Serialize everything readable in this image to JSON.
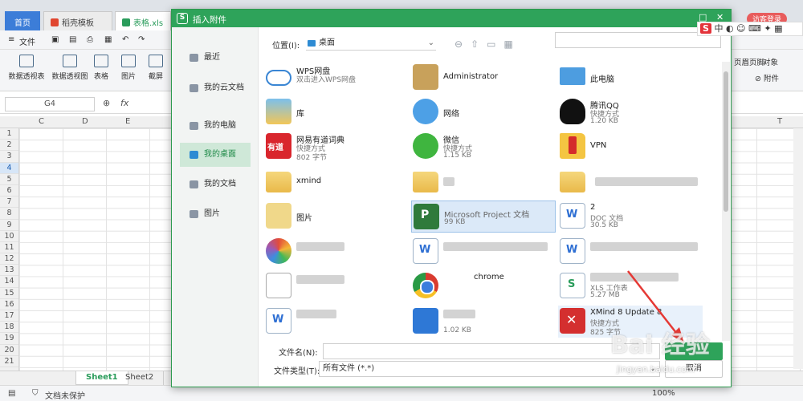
{
  "app": {
    "tabs": {
      "home": "首页",
      "templates": "稻壳模板",
      "file": "表格.xls"
    },
    "visitor": "访客登录",
    "menu": {
      "file": "文件"
    },
    "ribbon": {
      "pivot_table": "数据透视表",
      "pivot_chart": "数据透视图",
      "table": "表格",
      "picture": "图片",
      "screenshot": "截屏",
      "object": "对象",
      "header_footer": "页眉页脚",
      "attachment": "附件"
    },
    "formula": {
      "cell_ref": "G4",
      "fx": "fx"
    },
    "columns": [
      "C",
      "D",
      "E",
      "T"
    ],
    "rows": [
      "1",
      "2",
      "3",
      "4",
      "5",
      "6",
      "7",
      "8",
      "9",
      "10",
      "11",
      "12",
      "13",
      "14",
      "15",
      "16",
      "17",
      "18",
      "19",
      "20",
      "21"
    ],
    "selected_row": "4",
    "sheets": [
      "Sheet1",
      "Sheet2"
    ],
    "status": {
      "protect": "文档未保护",
      "zoom": "100%"
    }
  },
  "dialog": {
    "title": "插入附件",
    "sidebar": [
      {
        "label": "最近"
      },
      {
        "label": "我的云文档"
      },
      {
        "label": "我的电脑"
      },
      {
        "label": "我的桌面"
      },
      {
        "label": "我的文档"
      },
      {
        "label": "图片"
      }
    ],
    "location_label": "位置(I):",
    "location_value": "桌面",
    "files": [
      {
        "name": "WPS网盘",
        "sub": "双击进入WPS网盘",
        "size": "",
        "icon": "cloud-icon"
      },
      {
        "name": "Administrator",
        "sub": "",
        "size": "",
        "icon": "user-folder-icon"
      },
      {
        "name": "此电脑",
        "sub": "",
        "size": "",
        "icon": "computer-icon"
      },
      {
        "name": "库",
        "sub": "",
        "size": "",
        "icon": "library-icon"
      },
      {
        "name": "网络",
        "sub": "",
        "size": "",
        "icon": "network-icon"
      },
      {
        "name": "腾讯QQ",
        "sub": "快捷方式",
        "size": "1.20 KB",
        "icon": "qq-icon"
      },
      {
        "name": "网易有道词典",
        "sub": "快捷方式",
        "size": "802 字节",
        "icon": "youdao-icon"
      },
      {
        "name": "微信",
        "sub": "快捷方式",
        "size": "1.15 KB",
        "icon": "wechat-icon"
      },
      {
        "name": "VPN",
        "sub": "",
        "size": "",
        "icon": "folder-icon"
      },
      {
        "name": "xmind",
        "sub": "",
        "size": "",
        "icon": "folder-icon"
      },
      {
        "name": "图片",
        "sub": "",
        "size": "",
        "icon": "folder-icon"
      },
      {
        "name": "Microsoft Project 文档",
        "sub": "",
        "size": "99 KB",
        "icon": "project-icon"
      },
      {
        "name": "2",
        "sub": "DOC 文档",
        "size": "30.5 KB",
        "icon": "doc-icon"
      },
      {
        "name": "chrome",
        "sub": "",
        "size": "",
        "icon": "chrome-icon"
      },
      {
        "name": "XLS 工作表",
        "sub": "",
        "size": "5.27 MB",
        "icon": "xls-icon"
      },
      {
        "name": "XMind 8 Update 8",
        "sub": "快捷方式",
        "size": "825 字节",
        "icon": "xmind-icon"
      },
      {
        "name": "",
        "sub": "",
        "size": "1.02 KB",
        "icon": "wps-icon"
      }
    ],
    "filename_label": "文件名(N):",
    "filetype_label": "文件类型(T):",
    "filetype_value": "所有文件 (*.*)",
    "cancel_label": "取消"
  },
  "overlay": {
    "ime_label": "中",
    "watermark": "Bai 经验",
    "watermark_url": "jingyan.baidu.com"
  },
  "colors": {
    "accent": "#2ea35a",
    "selected_row": "#d7e6f7",
    "arrow": "#e53935"
  }
}
